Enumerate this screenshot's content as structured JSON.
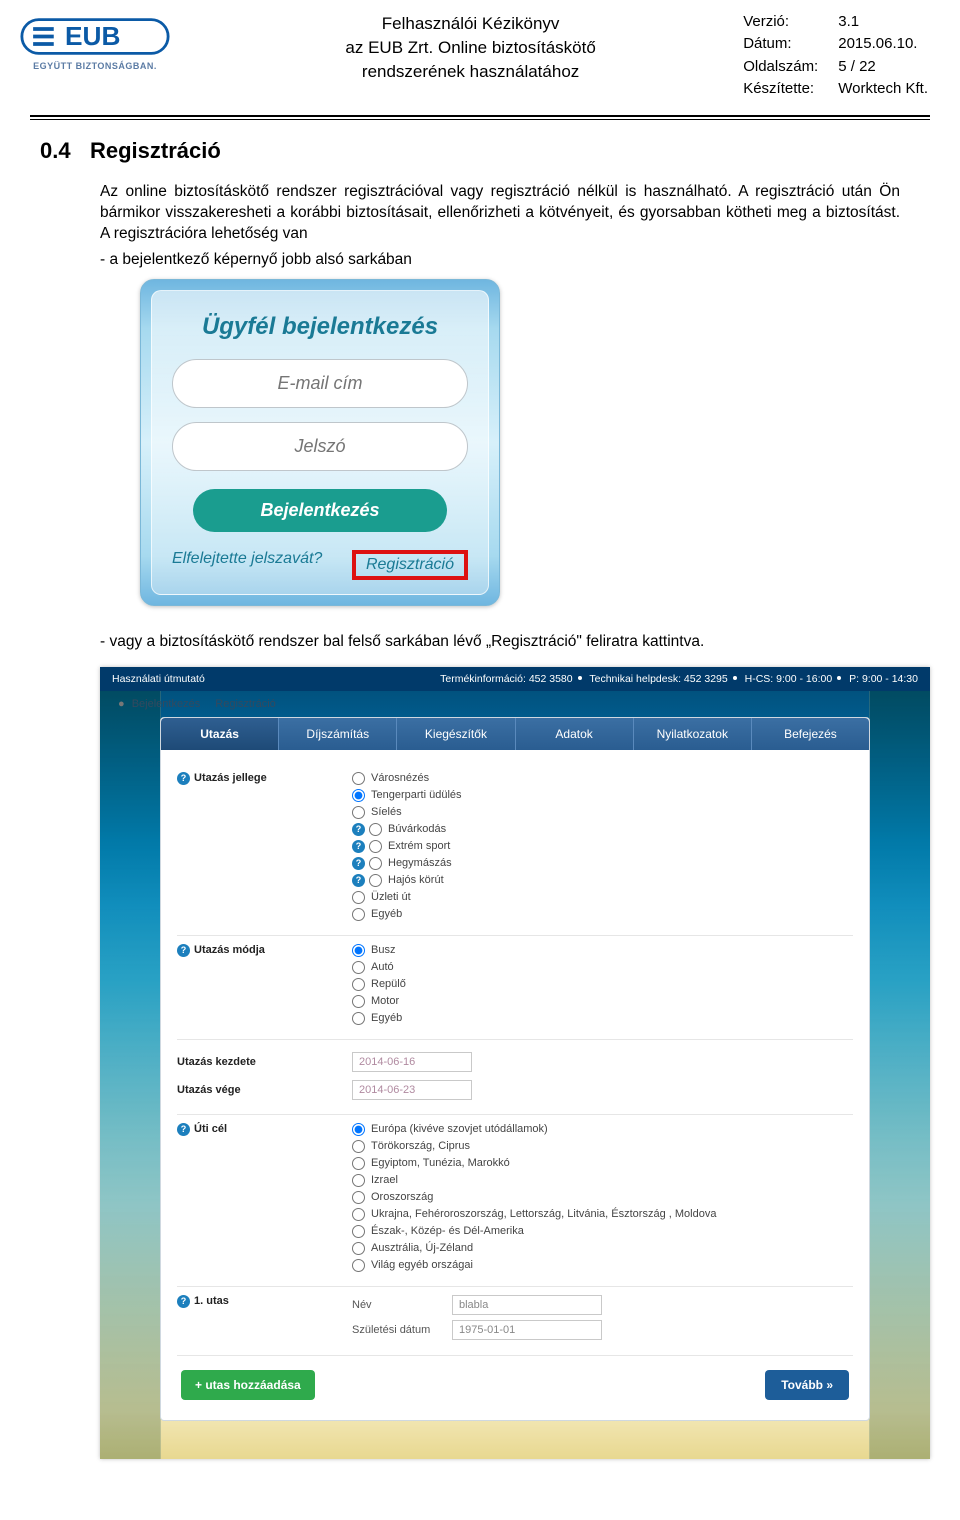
{
  "header": {
    "logo_text": "EUB",
    "logo_tag": "EGYÜTT BIZTONSÁGBAN.",
    "title_l1": "Felhasználói Kézikönyv",
    "title_l2": "az EUB Zrt. Online biztosításkötő",
    "title_l3": "rendszerének használatához",
    "meta": {
      "version_label": "Verzió:",
      "version": "3.1",
      "date_label": "Dátum:",
      "date": "2015.06.10.",
      "page_label": "Oldalszám:",
      "page": "5 / 22",
      "author_label": "Készítette:",
      "author": "Worktech Kft."
    }
  },
  "section": {
    "num": "0.4",
    "heading": "Regisztráció",
    "p1": "Az online biztosításkötő rendszer regisztrációval vagy regisztráció nélkül is használható. A regisztráció után Ön bármikor visszakeresheti a korábbi biztosításait, ellenőrizheti a kötvényeit, és gyorsabban kötheti meg a biztosítást. A regisztrációra lehetőség van",
    "b1": "- a bejelentkező képernyő jobb alsó sarkában",
    "p2": "- vagy a biztosításkötő rendszer bal felső sarkában lévő „Regisztráció\" feliratra kattintva."
  },
  "login": {
    "title": "Ügyfél bejelentkezés",
    "email_ph": "E-mail cím",
    "pass_ph": "Jelszó",
    "submit": "Bejelentkezés",
    "forgot": "Elfelejtette jelszavát?",
    "register": "Regisztráció"
  },
  "app": {
    "topbar": {
      "left": "Használati útmutató",
      "info1": "Termékinformáció: 452 3580",
      "info2": "Technikai helpdesk: 452 3295",
      "info3": "H-CS: 9:00 - 16:00",
      "info4": "P: 9:00 - 14:30"
    },
    "auth": {
      "login": "Bejelentkezés",
      "register": "Regisztráció"
    },
    "tabs": [
      "Utazás",
      "Díjszámítás",
      "Kiegészítők",
      "Adatok",
      "Nyilatkozatok",
      "Befejezés"
    ],
    "groups": {
      "jelleg_label": "Utazás jellege",
      "jelleg_opts": [
        "Városnézés",
        "Tengerparti üdülés",
        "Síelés",
        "Búvárkodás",
        "Extrém sport",
        "Hegymászás",
        "Hajós körút",
        "Üzleti út",
        "Egyéb"
      ],
      "jelleg_help_idx": [
        3,
        4,
        5,
        6
      ],
      "jelleg_checked": 1,
      "mod_label": "Utazás módja",
      "mod_opts": [
        "Busz",
        "Autó",
        "Repülő",
        "Motor",
        "Egyéb"
      ],
      "mod_checked": 0,
      "kezdet_label": "Utazás kezdete",
      "kezdet_val": "2014-06-16",
      "vege_label": "Utazás vége",
      "vege_val": "2014-06-23",
      "uticel_label": "Úti cél",
      "uticel_opts": [
        "Európa (kivéve szovjet utódállamok)",
        "Törökország, Ciprus",
        "Egyiptom, Tunézia, Marokkó",
        "Izrael",
        "Oroszország",
        "Ukrajna, Fehéroroszország, Lettország, Litvánia, Észtország , Moldova",
        "Észak-, Közép- és Dél-Amerika",
        "Ausztrália, Új-Zéland",
        "Világ egyéb országai"
      ],
      "uticel_checked": 0,
      "utas_label": "1. utas",
      "utas_name_label": "Név",
      "utas_name_val": "blabla",
      "utas_dob_label": "Születési dátum",
      "utas_dob_val": "1975-01-01"
    },
    "actions": {
      "add": "+ utas hozzáadása",
      "next": "Tovább »"
    }
  }
}
